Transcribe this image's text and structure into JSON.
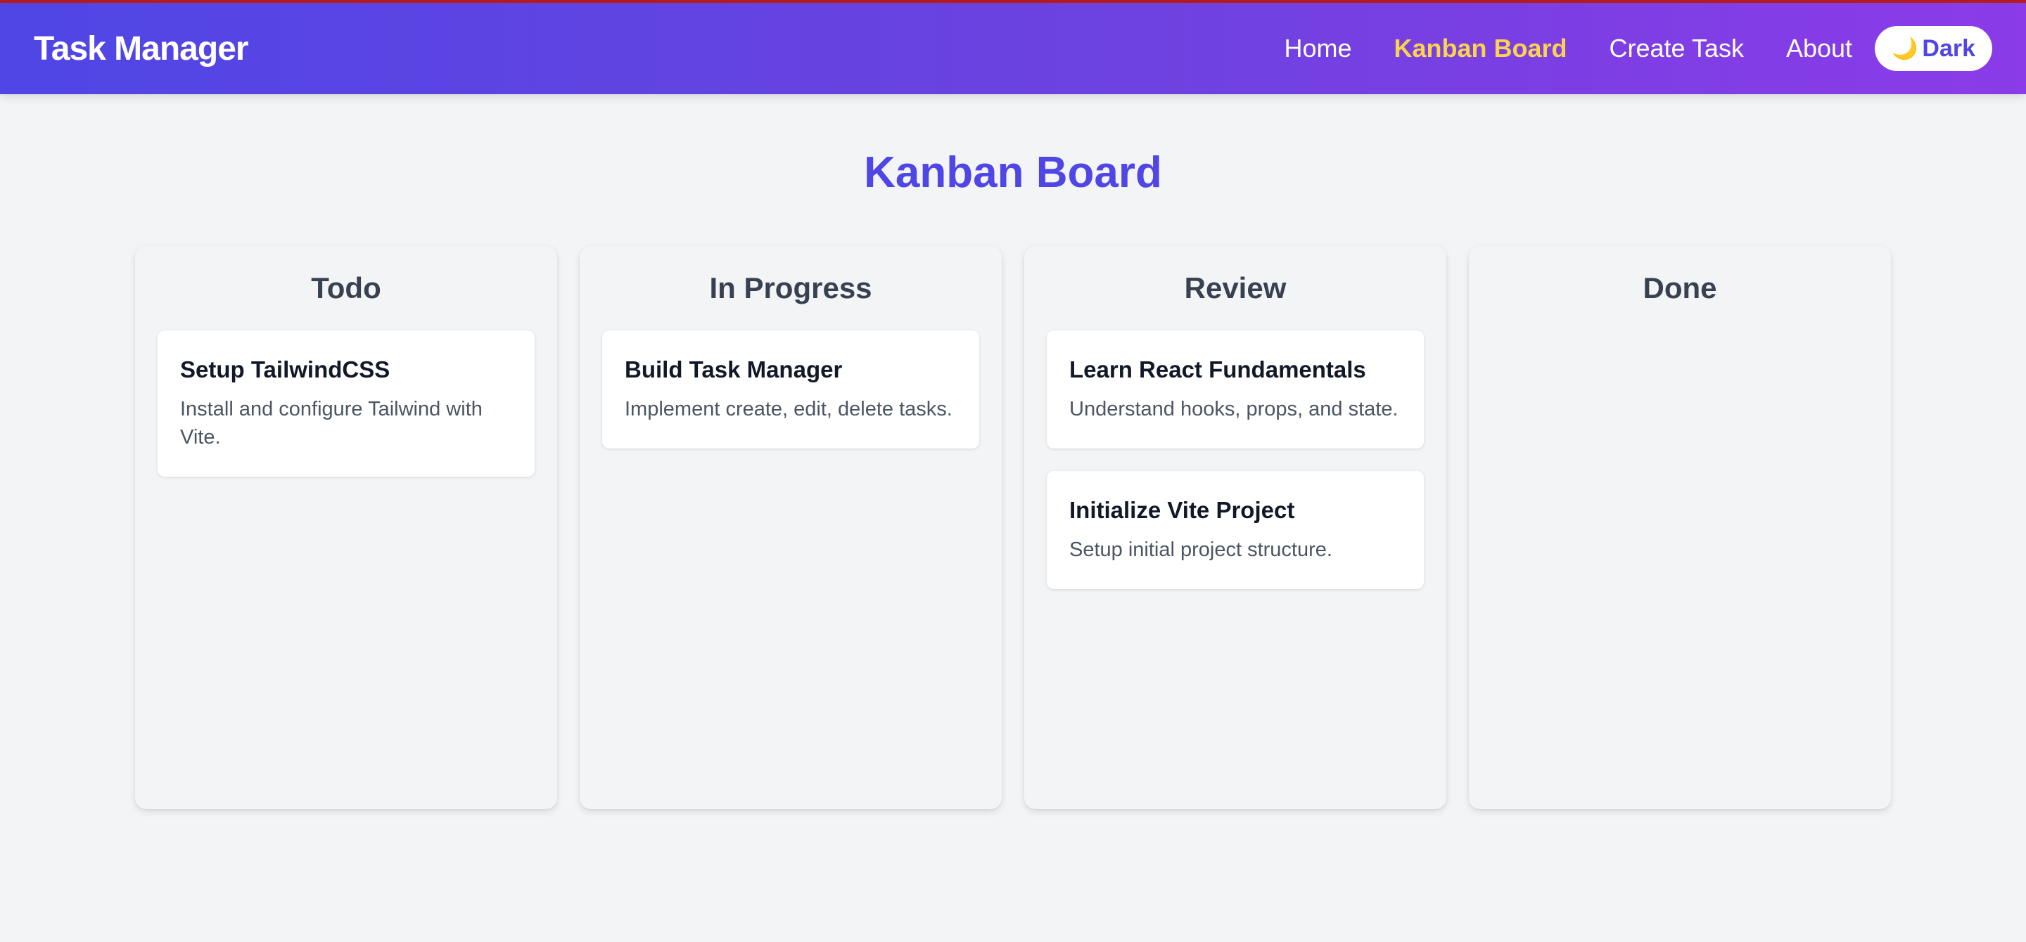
{
  "app": {
    "brand": "Task Manager"
  },
  "nav": {
    "links": [
      {
        "label": "Home",
        "active": false
      },
      {
        "label": "Kanban Board",
        "active": true
      },
      {
        "label": "Create Task",
        "active": false
      },
      {
        "label": "About",
        "active": false
      }
    ],
    "theme_toggle": {
      "icon": "moon-icon",
      "glyph": "🌙",
      "label": "Dark"
    }
  },
  "page": {
    "title": "Kanban Board"
  },
  "columns": [
    {
      "title": "Todo",
      "cards": [
        {
          "title": "Setup TailwindCSS",
          "description": "Install and configure Tailwind with Vite."
        }
      ]
    },
    {
      "title": "In Progress",
      "cards": [
        {
          "title": "Build Task Manager",
          "description": "Implement create, edit, delete tasks."
        }
      ]
    },
    {
      "title": "Review",
      "cards": [
        {
          "title": "Learn React Fundamentals",
          "description": "Understand hooks, props, and state."
        },
        {
          "title": "Initialize Vite Project",
          "description": "Setup initial project structure."
        }
      ]
    },
    {
      "title": "Done",
      "cards": []
    }
  ],
  "colors": {
    "accent": "#4f46e5",
    "active_link": "#fcd34d",
    "nav_gradient_start": "#4f46e5",
    "nav_gradient_end": "#8b3be8",
    "background": "#f3f4f6"
  }
}
